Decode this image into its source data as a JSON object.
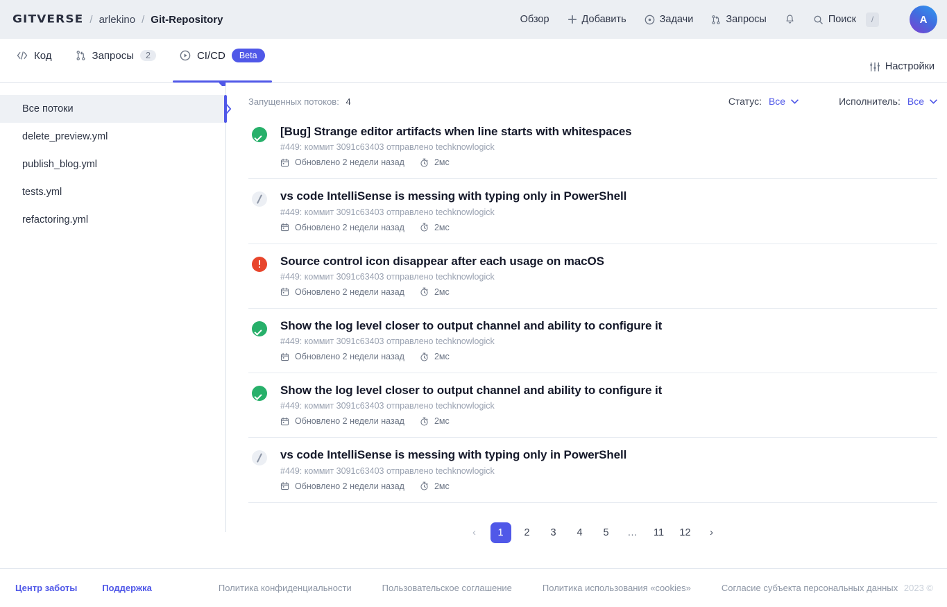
{
  "header": {
    "brand": "GITVERSE",
    "separator": "/",
    "owner": "arlekino",
    "repo": "Git-Repository",
    "nav": [
      {
        "label": "Обзор",
        "icon": ""
      },
      {
        "label": "Добавить",
        "icon": "plus-icon"
      },
      {
        "label": "Задачи",
        "icon": "issues-icon"
      },
      {
        "label": "Запросы",
        "icon": "pull-request-icon"
      },
      {
        "label": "",
        "icon": "bell-icon"
      },
      {
        "label": "Поиск",
        "icon": "search-icon",
        "shortcut": "/"
      }
    ],
    "avatar_initial": "A"
  },
  "tabs": [
    {
      "label": "Код",
      "icon": "code-icon",
      "badge": "",
      "active": false
    },
    {
      "label": "Запросы",
      "icon": "pull-request-icon",
      "badge": "2",
      "active": false
    },
    {
      "label": "CI/CD",
      "icon": "play-circle-icon",
      "badge": "Beta",
      "active": true
    }
  ],
  "settings_label": "Настройки",
  "sidebar": {
    "items": [
      {
        "label": "Все потоки",
        "active": true
      },
      {
        "label": "delete_preview.yml",
        "active": false
      },
      {
        "label": "publish_blog.yml",
        "active": false
      },
      {
        "label": "tests.yml",
        "active": false
      },
      {
        "label": "refactoring.yml",
        "active": false
      }
    ]
  },
  "filterbar": {
    "runs_label": "Запущенных потоков:",
    "runs_count": "4",
    "status_label": "Статус:",
    "status_value": "Все",
    "assignee_label": "Исполнитель:",
    "assignee_value": "Все"
  },
  "runs": [
    {
      "status": "success",
      "title": "[Bug] Strange editor artifacts when line starts with whitespaces",
      "subtitle": "#449: коммит 3091c63403 отправлено techknowlogick",
      "updated": "Обновлено 2 недели назад",
      "duration": "2мс"
    },
    {
      "status": "skipped",
      "title": "vs code IntelliSense is messing with typing only in PowerShell",
      "subtitle": "#449: коммит 3091c63403 отправлено techknowlogick",
      "updated": "Обновлено 2 недели назад",
      "duration": "2мс"
    },
    {
      "status": "error",
      "title": "Source control icon disappear after each usage on macOS",
      "subtitle": "#449: коммит 3091c63403 отправлено techknowlogick",
      "updated": "Обновлено 2 недели назад",
      "duration": "2мс"
    },
    {
      "status": "success",
      "title": "Show the log level closer to output channel and ability to configure it",
      "subtitle": "#449: коммит 3091c63403 отправлено techknowlogick",
      "updated": "Обновлено 2 недели назад",
      "duration": "2мс"
    },
    {
      "status": "success",
      "title": "Show the log level closer to output channel and ability to configure it",
      "subtitle": "#449: коммит 3091c63403 отправлено techknowlogick",
      "updated": "Обновлено 2 недели назад",
      "duration": "2мс"
    },
    {
      "status": "skipped",
      "title": "vs code IntelliSense is messing with typing only in PowerShell",
      "subtitle": "#449: коммит 3091c63403 отправлено techknowlogick",
      "updated": "Обновлено 2 недели назад",
      "duration": "2мс"
    }
  ],
  "pagination": {
    "prev": "‹",
    "next": "›",
    "pages": [
      "1",
      "2",
      "3",
      "4",
      "5",
      "…",
      "11",
      "12"
    ],
    "current": "1"
  },
  "footer": {
    "primary_links": [
      "Центр заботы",
      "Поддержка"
    ],
    "secondary_links": [
      "Политика конфиденциальности",
      "Пользовательское соглашение",
      "Политика использования «cookies»",
      "Согласие субъекта персональных данных"
    ],
    "copyright": "2023 ©"
  },
  "colors": {
    "accent": "#5058e8",
    "success": "#27b06a",
    "error": "#e8452c",
    "header_bg": "#eceff3"
  }
}
